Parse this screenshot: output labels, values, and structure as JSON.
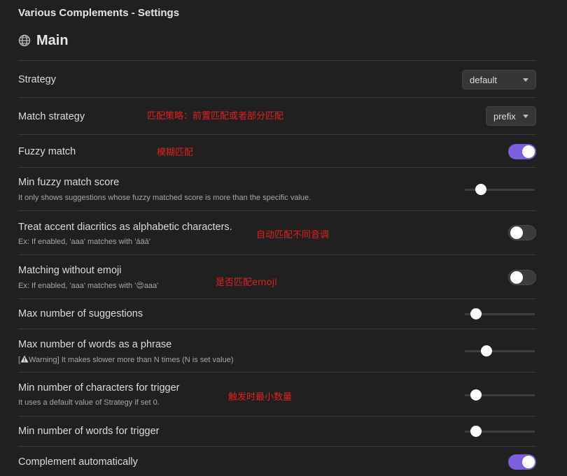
{
  "window": {
    "title": "Various Complements - Settings"
  },
  "section": {
    "title": "Main",
    "icon": "globe-icon"
  },
  "settings": [
    {
      "name": "Strategy",
      "control": "dropdown",
      "value": "default"
    },
    {
      "name": "Match strategy",
      "annotation": "匹配策略：前置匹配或者部分匹配",
      "control": "dropdown",
      "value": "prefix"
    },
    {
      "name": "Fuzzy match",
      "annotation": "模糊匹配",
      "control": "toggle",
      "value": true
    },
    {
      "name": "Min fuzzy match score",
      "description": "It only shows suggestions whose fuzzy matched score is more than the specific value.",
      "control": "slider",
      "value": 0.18
    },
    {
      "name": "Treat accent diacritics as alphabetic characters.",
      "description": "Ex: If enabled, 'aaa' matches with 'áäā'",
      "annotation": "自动匹配不同音调",
      "control": "toggle",
      "value": false
    },
    {
      "name": "Matching without emoji",
      "description_prefix": "Ex: If enabled, 'aaa' matches with '",
      "description_emoji": "😍",
      "description_suffix": "aaa'",
      "annotation": "是否匹配emoji",
      "control": "toggle",
      "value": false
    },
    {
      "name": "Max number of suggestions",
      "control": "slider",
      "value": 0.1
    },
    {
      "name": "Max number of words as a phrase",
      "description_prefix": "[",
      "description_warn": "Warning",
      "description_suffix": "] It makes slower more than N times (N is set value)",
      "control": "slider",
      "value": 0.27
    },
    {
      "name": "Min number of characters for trigger",
      "description": "It uses a default value of Strategy if set 0.",
      "annotation": "触发时最小数量",
      "control": "slider",
      "value": 0.09
    },
    {
      "name": "Min number of words for trigger",
      "control": "slider",
      "value": 0.09
    },
    {
      "name": "Complement automatically",
      "control": "toggle",
      "value": true
    }
  ],
  "colors": {
    "background": "#202020",
    "accent": "#7b5fdc",
    "annotation": "#e02020",
    "divider": "#3a3a3a"
  }
}
